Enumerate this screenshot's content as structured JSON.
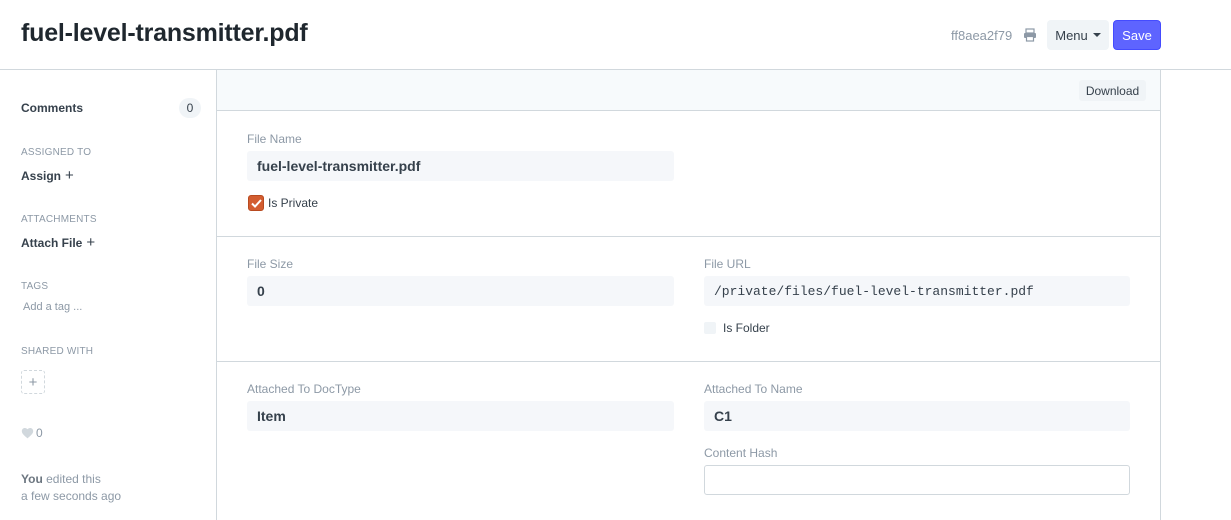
{
  "header": {
    "title": "fuel-level-transmitter.pdf",
    "doc_id": "ff8aea2f79",
    "menu_label": "Menu",
    "save_label": "Save"
  },
  "sidebar": {
    "comments_label": "Comments",
    "comments_count": "0",
    "assigned_to_label": "ASSIGNED TO",
    "assign_label": "Assign",
    "attachments_label": "ATTACHMENTS",
    "attach_file_label": "Attach File",
    "tags_label": "TAGS",
    "add_tag_placeholder": "Add a tag ...",
    "shared_with_label": "SHARED WITH",
    "likes_count": "0",
    "edited_user": "You",
    "edited_text": "edited this",
    "edited_time": "a few seconds ago"
  },
  "toolbar": {
    "download_label": "Download"
  },
  "form": {
    "file_name_label": "File Name",
    "file_name_value": "fuel-level-transmitter.pdf",
    "is_private_label": "Is Private",
    "is_private_checked": true,
    "file_size_label": "File Size",
    "file_size_value": "0",
    "file_url_label": "File URL",
    "file_url_value": "/private/files/fuel-level-transmitter.pdf",
    "is_folder_label": "Is Folder",
    "is_folder_checked": false,
    "attached_to_doctype_label": "Attached To DocType",
    "attached_to_doctype_value": "Item",
    "attached_to_name_label": "Attached To Name",
    "attached_to_name_value": "C1",
    "content_hash_label": "Content Hash",
    "content_hash_value": ""
  },
  "colors": {
    "primary": "#5e64ff",
    "checkbox_checked": "#d35d30",
    "muted_text": "#8d99a6",
    "border": "#d1d8dd"
  }
}
